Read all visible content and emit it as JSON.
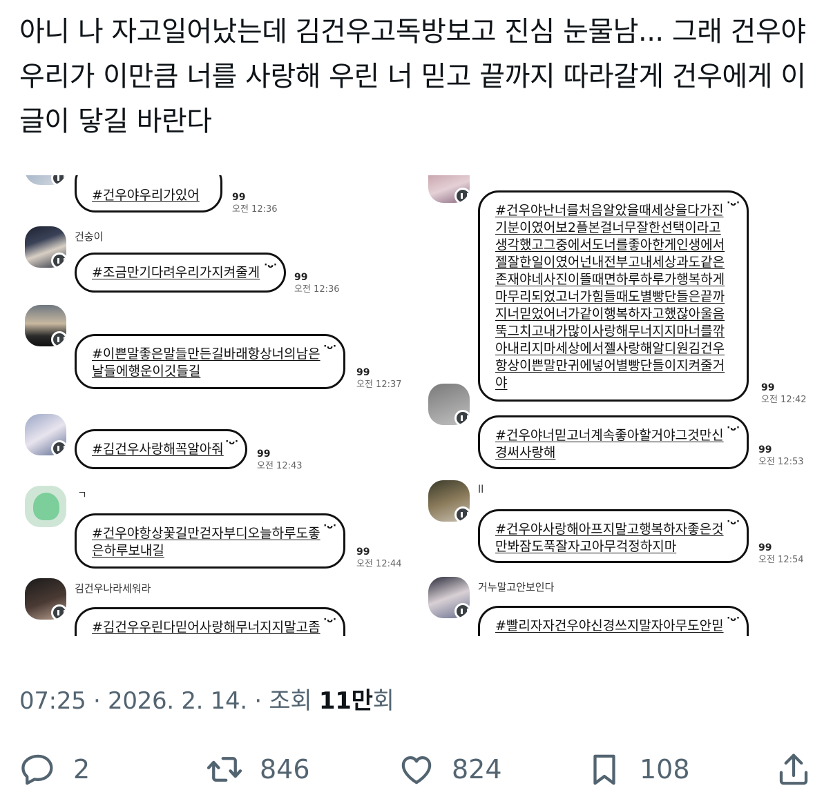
{
  "tweet": {
    "text": "아니 나 자고일어났는데 김건우고독방보고 진심 눈물남... 그래 건우야 우리가 이만큼 너를 사랑해 우린 너 믿고 끝까지 따라갈게 건우에게 이 글이 닿길 바란다"
  },
  "chat_left": [
    {
      "nick": "",
      "message": "#건우야우리가있어",
      "quote": "99",
      "time": "오전 12:36"
    },
    {
      "nick": "건숭이",
      "message": "#조금만기다려우리가지켜줄게",
      "quote": "99",
      "time": "오전 12:36"
    },
    {
      "nick": "",
      "message": "#이쁜말좋은말들만든길바래항상너의남은날들에행운이깃들길",
      "quote": "99",
      "time": "오전 12:37"
    },
    {
      "nick": "",
      "message": "#김건우사랑해꼭알아줘",
      "quote": "99",
      "time": "오전 12:43"
    },
    {
      "nick": "ㄱ",
      "message": "#건우야항상꽃길만걷자부디오늘하루도좋은하루보내길",
      "quote": "99",
      "time": "오전 12:44"
    },
    {
      "nick": "김건우나라세워라",
      "message": "#김건우우린다믿어사랑해무너지지말고좀",
      "quote": "",
      "time": ""
    }
  ],
  "chat_right": [
    {
      "nick": "",
      "message": "#건우야난너를처음알았을때세상을다가진기분이였어보2플본걸너무잘한선택이라고생각했고그중에서도너를좋아한게인생에서젤잘한일이였어넌내전부고내세상과도같은존재야네사진이뜰때면하루하루가행복하게마무리되었고너가힘들때도별빵단들은끝까지너믿었어너가같이행복하자고했잖아울음뚝그치고내가많이사랑해무너지지마너를깎아내리지마세상에서젤사랑해알디원김건우항상이쁜말만귀에넣어별빵단들이지켜줄거야",
      "quote": "99",
      "time": "오전 12:42"
    },
    {
      "nick": "",
      "message": "#건우야너믿고너계속좋아할거야그것만신경써사랑해",
      "quote": "99",
      "time": "오전 12:53"
    },
    {
      "nick": "ll",
      "message": "#건우야사랑해아프지말고행복하자좋은것만봐잠도푹잘자고아무걱정하지마",
      "quote": "99",
      "time": "오전 12:54"
    },
    {
      "nick": "거누말고안보인다",
      "message": "#빨리자자건우야신경쓰지말자아무도안믿",
      "quote": "",
      "time": ""
    }
  ],
  "footer": {
    "time_date": "07:25 · 2026. 2. 14. · 조회 ",
    "views_number": "11만",
    "views_suffix": "회"
  },
  "actions": {
    "reply_count": "2",
    "retweet_count": "846",
    "like_count": "824",
    "bookmark_count": "108"
  },
  "colors": {
    "text_primary": "#0f1419",
    "text_secondary": "#536471"
  },
  "icons": [
    "reply-icon",
    "retweet-icon",
    "like-icon",
    "bookmark-icon",
    "share-icon"
  ]
}
